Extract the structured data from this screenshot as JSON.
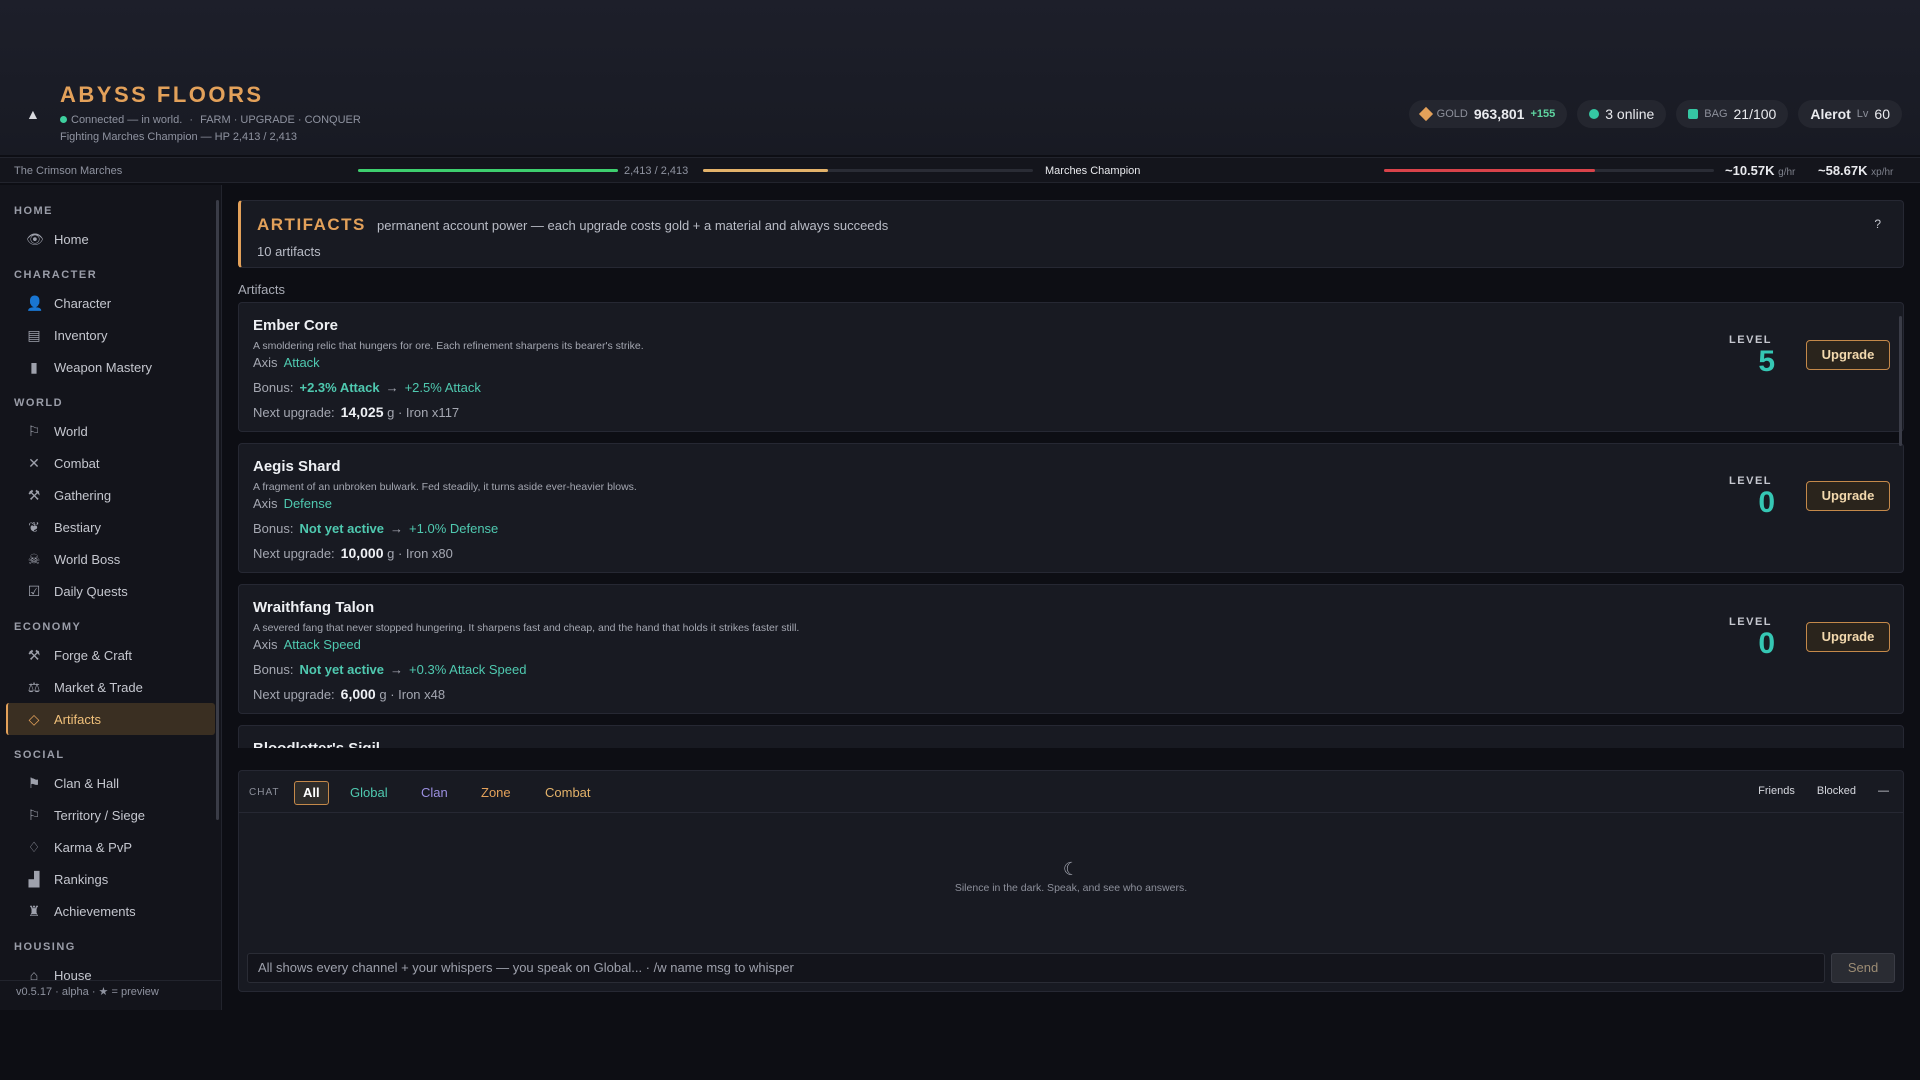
{
  "app": {
    "title": "ABYSS FLOORS",
    "status": "Connected — in world.",
    "tagline": "FARM · UPGRADE · CONQUER",
    "fighting": "Fighting Marches Champion — HP 2,413 / 2,413"
  },
  "top_chips": {
    "gold_label": "GOLD",
    "gold_value": "963,801",
    "gold_delta": "+155",
    "online": "3 online",
    "bag_label": "BAG",
    "bag_value": "21/100",
    "player_name": "Alerot",
    "player_lv_label": "Lv",
    "player_lv": "60"
  },
  "statusbar": {
    "zone": "The Crimson Marches",
    "hp_text": "2,413 / 2,413",
    "hp_fraction": 1.0,
    "xp_fraction": 0.38,
    "enemy": "Marches Champion",
    "enemy_hp_fraction": 0.64,
    "gold_rate": "~10.57K",
    "gold_rate_unit": "g/hr",
    "xp_rate": "~58.67K",
    "xp_rate_unit": "xp/hr"
  },
  "sidebar": {
    "sections": [
      {
        "label": "HOME",
        "items": [
          {
            "label": "Home",
            "icon": "eye-icon"
          }
        ]
      },
      {
        "label": "CHARACTER",
        "items": [
          {
            "label": "Character",
            "icon": "person-icon"
          },
          {
            "label": "Inventory",
            "icon": "chest-icon"
          },
          {
            "label": "Weapon Mastery",
            "icon": "book-icon"
          }
        ]
      },
      {
        "label": "WORLD",
        "items": [
          {
            "label": "World",
            "icon": "signpost-icon"
          },
          {
            "label": "Combat",
            "icon": "crossed-swords-icon"
          },
          {
            "label": "Gathering",
            "icon": "pickaxe-icon"
          },
          {
            "label": "Bestiary",
            "icon": "beast-icon"
          },
          {
            "label": "World Boss",
            "icon": "skull-icon"
          },
          {
            "label": "Daily Quests",
            "icon": "checkbox-icon"
          }
        ]
      },
      {
        "label": "ECONOMY",
        "items": [
          {
            "label": "Forge & Craft",
            "icon": "anvil-icon"
          },
          {
            "label": "Market & Trade",
            "icon": "scales-icon"
          },
          {
            "label": "Artifacts",
            "icon": "gem-icon"
          }
        ]
      },
      {
        "label": "SOCIAL",
        "items": [
          {
            "label": "Clan & Hall",
            "icon": "banner-icon"
          },
          {
            "label": "Territory / Siege",
            "icon": "flag-icon"
          },
          {
            "label": "Karma & PvP",
            "icon": "drop-icon"
          },
          {
            "label": "Rankings",
            "icon": "podium-icon"
          },
          {
            "label": "Achievements",
            "icon": "trophy-icon"
          }
        ]
      },
      {
        "label": "HOUSING",
        "items": [
          {
            "label": "House",
            "icon": "house-icon"
          }
        ]
      }
    ],
    "version": "v0.5.17 · alpha · ★ = preview"
  },
  "header": {
    "title": "ARTIFACTS",
    "description": "permanent account power — each upgrade costs gold + a material and always succeeds",
    "count": "10 artifacts",
    "help": "?"
  },
  "list_label": "Artifacts",
  "labels": {
    "axis": "Axis",
    "bonus": "Bonus:",
    "next_upgrade": "Next upgrade:",
    "level": "LEVEL",
    "upgrade": "Upgrade",
    "gold_unit": "g"
  },
  "artifacts": [
    {
      "name": "Ember Core",
      "lore": "A smoldering relic that hungers for ore. Each refinement sharpens its bearer's strike.",
      "axis": "Attack",
      "bonus_current": "+2.3% Attack",
      "bonus_next": "+2.5% Attack",
      "cost": "14,025",
      "material": "Iron x117",
      "level": "5"
    },
    {
      "name": "Aegis Shard",
      "lore": "A fragment of an unbroken bulwark. Fed steadily, it turns aside ever-heavier blows.",
      "axis": "Defense",
      "bonus_current": "Not yet active",
      "bonus_next": "+1.0% Defense",
      "cost": "10,000",
      "material": "Iron x80",
      "level": "0"
    },
    {
      "name": "Wraithfang Talon",
      "lore": "A severed fang that never stopped hungering. It sharpens fast and cheap, and the hand that holds it strikes faster still.",
      "axis": "Attack Speed",
      "bonus_current": "Not yet active",
      "bonus_next": "+0.3% Attack Speed",
      "cost": "6,000",
      "material": "Iron x48",
      "level": "0"
    },
    {
      "name": "Bloodletter's Sigil"
    }
  ],
  "chat": {
    "label": "CHAT",
    "tabs": [
      "All",
      "Global",
      "Clan",
      "Zone",
      "Combat"
    ],
    "friends": "Friends",
    "blocked": "Blocked",
    "minimize": "—",
    "empty_text": "Silence in the dark. Speak, and see who answers.",
    "input_placeholder": "All shows every channel + your whispers — you speak on Global... · /w name msg to whisper",
    "send": "Send"
  },
  "colors": {
    "accent": "#e3a15a",
    "teal": "#35c7b4",
    "hp": "#3ecf6e",
    "xp": "#e3b26a",
    "enemy_hp": "#d9434a"
  }
}
